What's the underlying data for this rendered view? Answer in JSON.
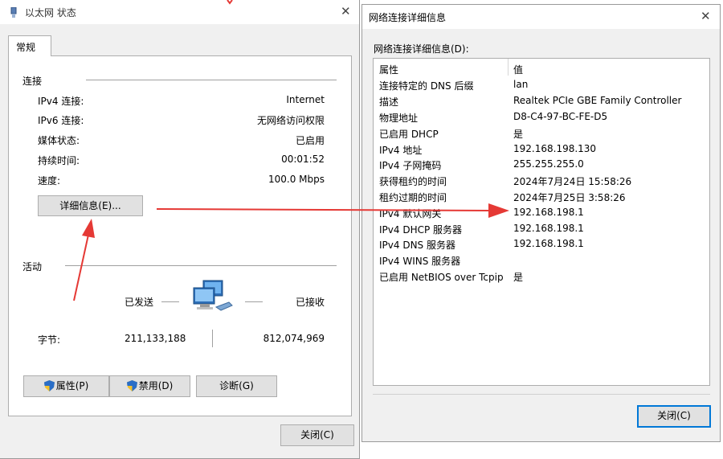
{
  "left_dialog": {
    "title": "以太网 状态",
    "tab": "常规",
    "connection_section": "连接",
    "rows": [
      {
        "label": "IPv4 连接:",
        "value": "Internet"
      },
      {
        "label": "IPv6 连接:",
        "value": "无网络访问权限"
      },
      {
        "label": "媒体状态:",
        "value": "已启用"
      },
      {
        "label": "持续时间:",
        "value": "00:01:52"
      },
      {
        "label": "速度:",
        "value": "100.0 Mbps"
      }
    ],
    "details_button": "详细信息(E)...",
    "activity_section": "活动",
    "sent_label": "已发送",
    "received_label": "已接收",
    "bytes_label": "字节:",
    "bytes_sent": "211,133,188",
    "bytes_received": "812,074,969",
    "properties_button": "属性(P)",
    "disable_button": "禁用(D)",
    "diagnose_button": "诊断(G)",
    "close_button": "关闭(C)"
  },
  "right_dialog": {
    "title": "网络连接详细信息",
    "list_label": "网络连接详细信息(D):",
    "col_property": "属性",
    "col_value": "值",
    "rows": [
      {
        "property": "连接特定的 DNS 后缀",
        "value": "lan"
      },
      {
        "property": "描述",
        "value": "Realtek PCIe GBE Family Controller"
      },
      {
        "property": "物理地址",
        "value": "D8-C4-97-BC-FE-D5"
      },
      {
        "property": "已启用 DHCP",
        "value": "是"
      },
      {
        "property": "IPv4 地址",
        "value": "192.168.198.130"
      },
      {
        "property": "IPv4 子网掩码",
        "value": "255.255.255.0"
      },
      {
        "property": "获得租约的时间",
        "value": "2024年7月24日 15:58:26"
      },
      {
        "property": "租约过期的时间",
        "value": "2024年7月25日 3:58:26"
      },
      {
        "property": "IPv4 默认网关",
        "value": "192.168.198.1"
      },
      {
        "property": "IPv4 DHCP 服务器",
        "value": "192.168.198.1"
      },
      {
        "property": "IPv4 DNS 服务器",
        "value": "192.168.198.1"
      },
      {
        "property": "IPv4 WINS 服务器",
        "value": ""
      },
      {
        "property": "已启用 NetBIOS over Tcpip",
        "value": "是"
      }
    ],
    "close_button": "关闭(C)"
  },
  "colors": {
    "annotation_arrow": "#e53935",
    "default_button_border": "#0078d7",
    "dialog_background": "#f0f0f0"
  },
  "icons": [
    "network-adapter-icon",
    "close-icon",
    "shield-icon",
    "computers-icon"
  ]
}
